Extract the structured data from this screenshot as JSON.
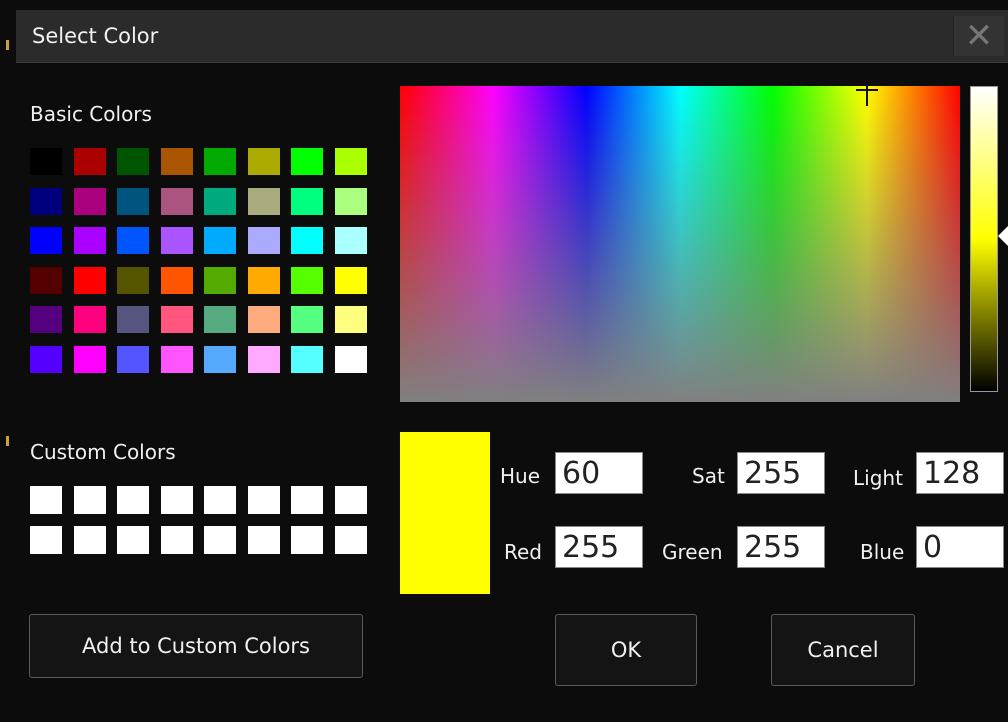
{
  "dialog": {
    "title": "Select Color",
    "close_glyph": "✕"
  },
  "basic_colors": {
    "label": "Basic Colors",
    "swatches": [
      "#000000",
      "#aa0000",
      "#005500",
      "#aa5500",
      "#00aa00",
      "#aaaa00",
      "#00ff00",
      "#aaff00",
      "#00007f",
      "#aa007f",
      "#00557f",
      "#aa557f",
      "#00aa7f",
      "#aaaa7f",
      "#00ff7f",
      "#aaff7f",
      "#0000ff",
      "#aa00ff",
      "#0055ff",
      "#aa55ff",
      "#00aaff",
      "#aaaaff",
      "#00ffff",
      "#aaffff",
      "#550000",
      "#ff0000",
      "#555500",
      "#ff5500",
      "#55aa00",
      "#ffaa00",
      "#55ff00",
      "#ffff00",
      "#55007f",
      "#ff007f",
      "#55557f",
      "#ff557f",
      "#55aa7f",
      "#ffaa7f",
      "#55ff7f",
      "#ffff7f",
      "#5500ff",
      "#ff00ff",
      "#5555ff",
      "#ff55ff",
      "#55aaff",
      "#ffaaff",
      "#55ffff",
      "#ffffff"
    ]
  },
  "custom_colors": {
    "label": "Custom Colors",
    "swatches": [
      "#ffffff",
      "#ffffff",
      "#ffffff",
      "#ffffff",
      "#ffffff",
      "#ffffff",
      "#ffffff",
      "#ffffff",
      "#ffffff",
      "#ffffff",
      "#ffffff",
      "#ffffff",
      "#ffffff",
      "#ffffff",
      "#ffffff",
      "#ffffff"
    ]
  },
  "current_color": "#ffff00",
  "fields": {
    "hue": {
      "label": "Hue",
      "value": "60"
    },
    "sat": {
      "label": "Sat",
      "value": "255"
    },
    "light": {
      "label": "Light",
      "value": "128"
    },
    "red": {
      "label": "Red",
      "value": "255"
    },
    "green": {
      "label": "Green",
      "value": "255"
    },
    "blue": {
      "label": "Blue",
      "value": "0"
    }
  },
  "buttons": {
    "add_custom": "Add to Custom Colors",
    "ok": "OK",
    "cancel": "Cancel"
  }
}
